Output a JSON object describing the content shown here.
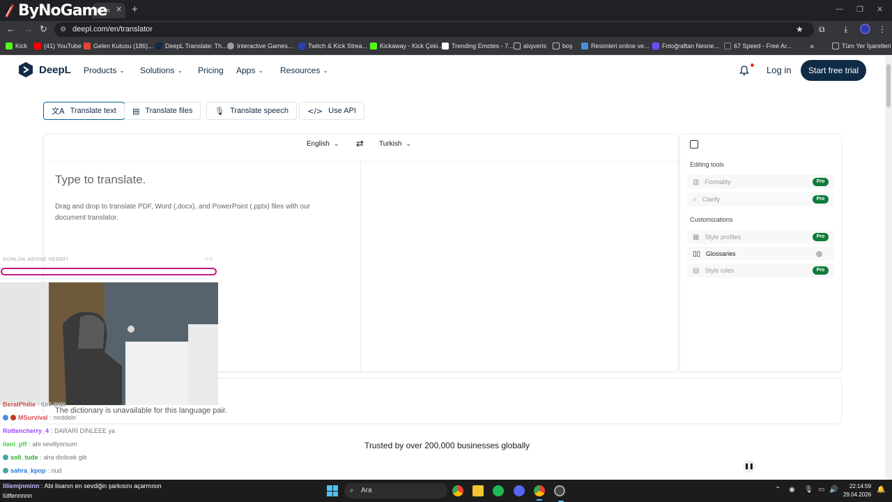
{
  "browser": {
    "tab_title": "d's m",
    "watermark": "ByNoGame",
    "url": "deepl.com/en/translator",
    "bookmarks": [
      {
        "label": "Kick",
        "color": "#53fc18"
      },
      {
        "label": "(41) YouTube",
        "color": "#ff0000"
      },
      {
        "label": "Gelen Kutusu (186)...",
        "color": "#ea4335"
      },
      {
        "label": "DeepL Translate: Th...",
        "color": "#0f2b46"
      },
      {
        "label": "Interactive Games...",
        "color": "#9e9e9e"
      },
      {
        "label": "Twitch & Kick Strea...",
        "color": "#2b3fb0"
      },
      {
        "label": "Kickaway - Kick Çeki...",
        "color": "#53fc18"
      },
      {
        "label": "Trending Emotes - 7...",
        "color": "#ffffff"
      },
      {
        "label": "alışveris",
        "color": "#c0c0c0"
      },
      {
        "label": "boş",
        "color": "#c0c0c0"
      },
      {
        "label": "Resimleri online ve...",
        "color": "#4a90d9"
      },
      {
        "label": "Fotoğraftan Nesne...",
        "color": "#6a4cff"
      },
      {
        "label": "67 Speed - Free Ar...",
        "color": "#333333"
      }
    ],
    "all_bookmarks": "Tüm Yer İşaretleri"
  },
  "deepl": {
    "logo": "DeepL",
    "nav": [
      "Products",
      "Solutions",
      "Pricing",
      "Apps",
      "Resources"
    ],
    "login": "Log in",
    "cta": "Start free trial",
    "modes": [
      "Translate text",
      "Translate files",
      "Translate speech",
      "Use API"
    ],
    "source_lang": "English",
    "target_lang": "Turkish",
    "placeholder": "Type to translate.",
    "hint": "Drag and drop to translate PDF, Word (.docx), and PowerPoint (.pptx) files with our document translator.",
    "editing_tools_heading": "Editing tools",
    "editing_tools": [
      "Formality",
      "Clarify"
    ],
    "customizations_heading": "Customizations",
    "customizations": [
      "Style profiles",
      "Glossaries",
      "Style rules"
    ],
    "pro_badge": "Pro",
    "dictionary_msg": "The dictionary is unavailable for this language pair.",
    "trusted": "Trusted by over 200,000 businesses globally"
  },
  "overlay": {
    "goal_label": "GÜNLÜK ABONE HEDEFİ",
    "goal_count": "0 0",
    "chat": [
      {
        "name": "BeratPhilie",
        "msg": ": türk aras",
        "color": "#c84a4a"
      },
      {
        "name": "MSurvival",
        "msg": ": mrddeln",
        "color": "#e05050"
      },
      {
        "name": "Rottencherry_4",
        "msg": ": DARARİ DİNLEEE ya",
        "color": "#9b4dff"
      },
      {
        "name": "ilani_pff",
        "msg": ": abi sevillyorsum",
        "color": "#4cc94c"
      },
      {
        "name": "soli_tude",
        "msg": ": aha dinlicek gib",
        "color": "#2faa2f"
      },
      {
        "name": "sahra_kpop",
        "msg": ": nud",
        "color": "#2a7ad8"
      }
    ],
    "taskbar_chat_name": "liliemjnminn",
    "taskbar_chat_msg": ": Abi lisanın en sevdiğin şarkısını açarmısın lütfennnnn"
  },
  "taskbar": {
    "search": "Ara",
    "time": "22:14:59",
    "date": "29.04.2026"
  }
}
